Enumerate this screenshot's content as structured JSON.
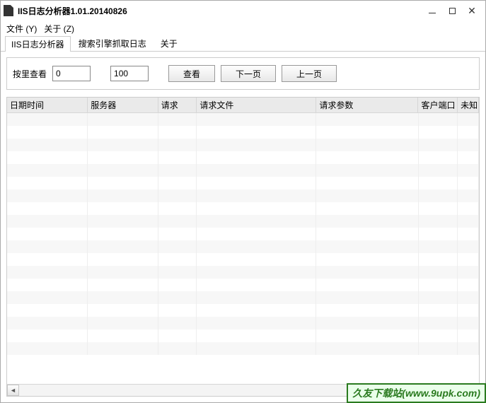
{
  "titlebar": {
    "title": "IIS日志分析器1.01.20140826"
  },
  "menubar": {
    "file": "文件 (Y)",
    "about": "关于 (Z)"
  },
  "tabs": {
    "tab1": "IIS日志分析器",
    "tab2": "搜索引擎抓取日志",
    "tab3": "关于"
  },
  "controls": {
    "label": "按里查看",
    "from": "0",
    "to": "100",
    "view": "查看",
    "next": "下一页",
    "prev": "上一页"
  },
  "table": {
    "headers": {
      "c0": "日期时间",
      "c1": "服务器",
      "c2": "请求",
      "c3": "请求文件",
      "c4": "请求参数",
      "c5": "客户端口",
      "c6": "未知"
    }
  },
  "watermark": "久友下载站(www.9upk.com)"
}
